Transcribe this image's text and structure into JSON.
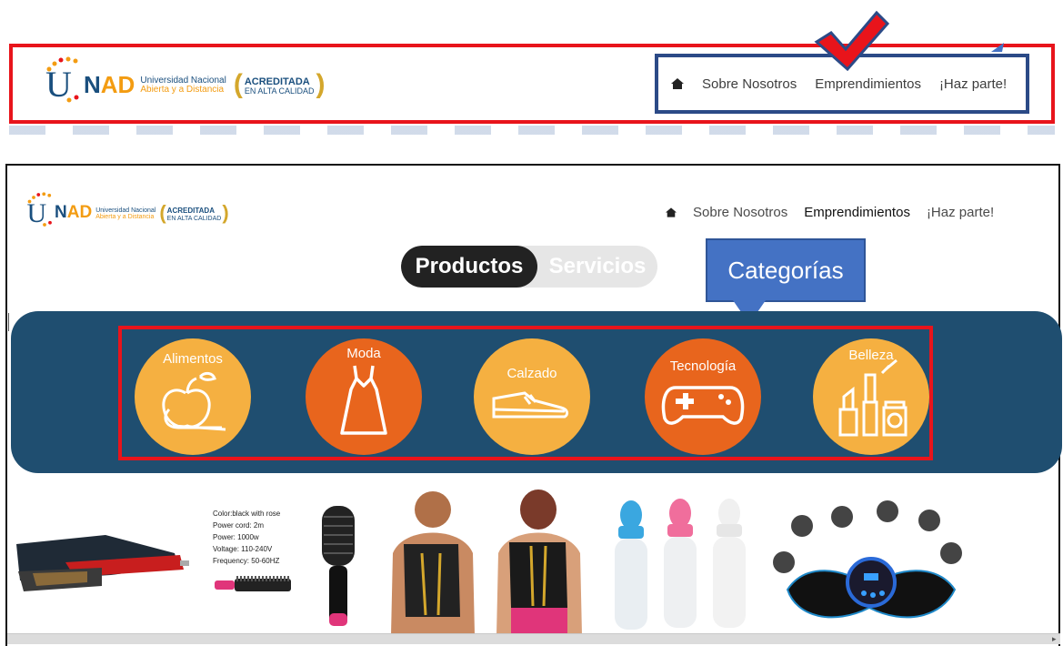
{
  "top_header": {
    "logo": {
      "word": "UNAD",
      "university_line1": "Universidad Nacional",
      "university_line2": "Abierta y a Distancia",
      "accreditation_line1": "ACREDITADA",
      "accreditation_line2": "EN ALTA CALIDAD"
    },
    "nav": [
      "Sobre Nosotros",
      "Emprendimientos",
      "¡Haz parte!"
    ]
  },
  "site": {
    "nav": [
      {
        "label": "Sobre Nosotros",
        "active": false
      },
      {
        "label": "Emprendimientos",
        "active": true
      },
      {
        "label": "¡Haz parte!",
        "active": false
      }
    ],
    "toggle": {
      "active": "Productos",
      "inactive": "Servicios"
    }
  },
  "callout": {
    "text": "Categorías",
    "color": "#4472c4"
  },
  "categories": [
    {
      "label": "Alimentos",
      "color": "#f5b041",
      "icon": "fruit-icon"
    },
    {
      "label": "Moda",
      "color": "#e8651d",
      "icon": "dress-icon"
    },
    {
      "label": "Calzado",
      "color": "#f5b041",
      "icon": "shoe-icon"
    },
    {
      "label": "Tecnología",
      "color": "#e8651d",
      "icon": "gamepad-icon"
    },
    {
      "label": "Belleza",
      "color": "#f5b041",
      "icon": "cosmetics-icon"
    }
  ],
  "products": {
    "specs": [
      "Color:black with rose",
      "Power cord: 2m",
      "Power: 1000w",
      "Voltage: 110-240V",
      "Frequency: 50-60HZ"
    ],
    "items": [
      "hair-straightener",
      "hot-air-brush",
      "posture-corrector",
      "baby-spoon-bottles",
      "ems-massager"
    ]
  },
  "colors": {
    "annotation_red": "#e8141b",
    "annotation_blue": "#2b4a87",
    "band": "#1f4e70",
    "orange": "#e8651d",
    "yellow": "#f5b041"
  }
}
